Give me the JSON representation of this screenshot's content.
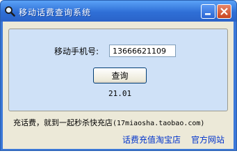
{
  "window": {
    "title": "移动话费查询系统",
    "icon": "magnifier-icon",
    "minimize_icon": "minimize-icon",
    "close_icon": "close-icon"
  },
  "form": {
    "phone_label": "移动手机号:",
    "phone_value": "13666621109",
    "query_button": "查询",
    "result": "21.01"
  },
  "footer": {
    "promo_text": "充话费，就到一起秒杀快充店",
    "promo_url": "(17miaosha.taobao.com)",
    "link_shop": "话费充值淘宝店",
    "link_site": "官方网站"
  },
  "colors": {
    "titlebar": "#2f6fd6",
    "groupbox": "#cfe1f7",
    "link": "#0033cc"
  }
}
